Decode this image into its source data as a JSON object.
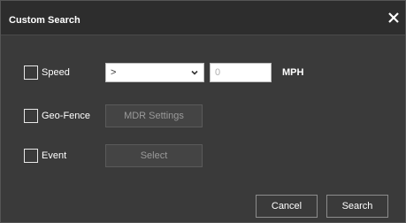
{
  "dialog": {
    "title": "Custom Search",
    "close_icon": "close-icon"
  },
  "speed": {
    "label": "Speed",
    "checked": false,
    "operator_value": ">",
    "value_placeholder": "0",
    "unit": "MPH"
  },
  "geofence": {
    "label": "Geo-Fence",
    "checked": false,
    "button_label": "MDR Settings"
  },
  "event": {
    "label": "Event",
    "checked": false,
    "button_label": "Select"
  },
  "footer": {
    "cancel_label": "Cancel",
    "search_label": "Search"
  }
}
